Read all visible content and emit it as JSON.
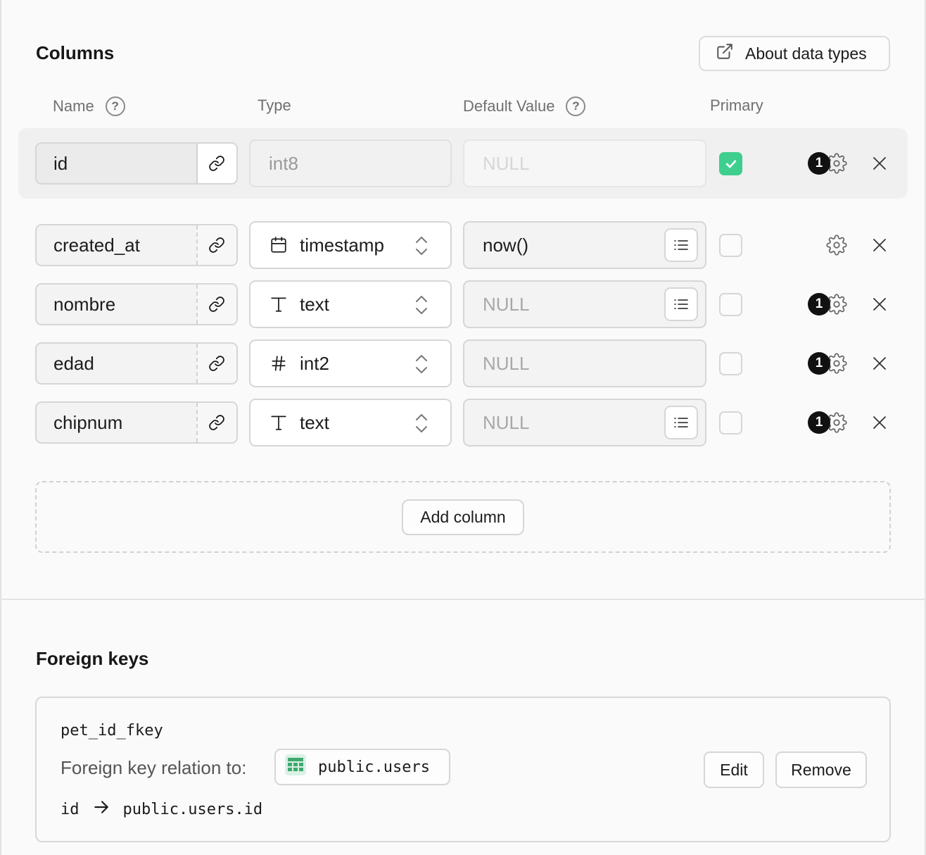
{
  "columns_section": {
    "title": "Columns",
    "about_button": "About data types",
    "headers": {
      "name": "Name",
      "type": "Type",
      "default_value": "Default Value",
      "primary": "Primary"
    },
    "help_glyph": "?",
    "rows": [
      {
        "name": "id",
        "type": "int8",
        "type_icon": "none",
        "default": "NULL",
        "default_is_placeholder": true,
        "primary": true,
        "badge": "1",
        "has_list_button": false
      },
      {
        "name": "created_at",
        "type": "timestamp",
        "type_icon": "calendar-icon",
        "default": "now()",
        "default_is_placeholder": false,
        "primary": false,
        "badge": "",
        "has_list_button": true
      },
      {
        "name": "nombre",
        "type": "text",
        "type_icon": "text-type-icon",
        "default": "NULL",
        "default_is_placeholder": true,
        "primary": false,
        "badge": "1",
        "has_list_button": true
      },
      {
        "name": "edad",
        "type": "int2",
        "type_icon": "hash-icon",
        "default": "NULL",
        "default_is_placeholder": true,
        "primary": false,
        "badge": "1",
        "has_list_button": false
      },
      {
        "name": "chipnum",
        "type": "text",
        "type_icon": "text-type-icon",
        "default": "NULL",
        "default_is_placeholder": true,
        "primary": false,
        "badge": "1",
        "has_list_button": true
      }
    ],
    "add_column_button": "Add column"
  },
  "foreign_keys_section": {
    "title": "Foreign keys",
    "key": {
      "name": "pet_id_fkey",
      "relation_label": "Foreign key relation to:",
      "target_table": "public.users",
      "source_column": "id",
      "target_column": "public.users.id",
      "edit_button": "Edit",
      "remove_button": "Remove"
    }
  },
  "colors": {
    "accent_green": "#3ecf8e",
    "badge_black": "#111111"
  }
}
